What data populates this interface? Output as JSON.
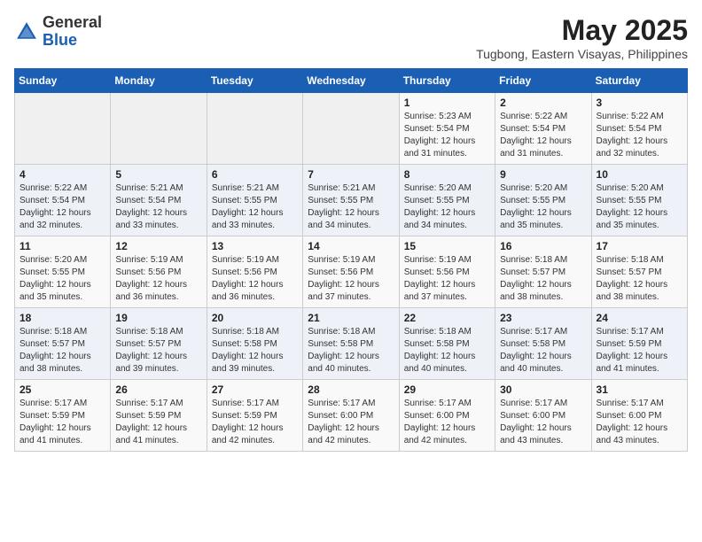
{
  "header": {
    "logo_general": "General",
    "logo_blue": "Blue",
    "month_year": "May 2025",
    "location": "Tugbong, Eastern Visayas, Philippines"
  },
  "weekdays": [
    "Sunday",
    "Monday",
    "Tuesday",
    "Wednesday",
    "Thursday",
    "Friday",
    "Saturday"
  ],
  "weeks": [
    [
      {
        "day": "",
        "info": ""
      },
      {
        "day": "",
        "info": ""
      },
      {
        "day": "",
        "info": ""
      },
      {
        "day": "",
        "info": ""
      },
      {
        "day": "1",
        "sunrise": "5:23 AM",
        "sunset": "5:54 PM",
        "daylight": "12 hours and 31 minutes."
      },
      {
        "day": "2",
        "sunrise": "5:22 AM",
        "sunset": "5:54 PM",
        "daylight": "12 hours and 31 minutes."
      },
      {
        "day": "3",
        "sunrise": "5:22 AM",
        "sunset": "5:54 PM",
        "daylight": "12 hours and 32 minutes."
      }
    ],
    [
      {
        "day": "4",
        "sunrise": "5:22 AM",
        "sunset": "5:54 PM",
        "daylight": "12 hours and 32 minutes."
      },
      {
        "day": "5",
        "sunrise": "5:21 AM",
        "sunset": "5:54 PM",
        "daylight": "12 hours and 33 minutes."
      },
      {
        "day": "6",
        "sunrise": "5:21 AM",
        "sunset": "5:55 PM",
        "daylight": "12 hours and 33 minutes."
      },
      {
        "day": "7",
        "sunrise": "5:21 AM",
        "sunset": "5:55 PM",
        "daylight": "12 hours and 34 minutes."
      },
      {
        "day": "8",
        "sunrise": "5:20 AM",
        "sunset": "5:55 PM",
        "daylight": "12 hours and 34 minutes."
      },
      {
        "day": "9",
        "sunrise": "5:20 AM",
        "sunset": "5:55 PM",
        "daylight": "12 hours and 35 minutes."
      },
      {
        "day": "10",
        "sunrise": "5:20 AM",
        "sunset": "5:55 PM",
        "daylight": "12 hours and 35 minutes."
      }
    ],
    [
      {
        "day": "11",
        "sunrise": "5:20 AM",
        "sunset": "5:55 PM",
        "daylight": "12 hours and 35 minutes."
      },
      {
        "day": "12",
        "sunrise": "5:19 AM",
        "sunset": "5:56 PM",
        "daylight": "12 hours and 36 minutes."
      },
      {
        "day": "13",
        "sunrise": "5:19 AM",
        "sunset": "5:56 PM",
        "daylight": "12 hours and 36 minutes."
      },
      {
        "day": "14",
        "sunrise": "5:19 AM",
        "sunset": "5:56 PM",
        "daylight": "12 hours and 37 minutes."
      },
      {
        "day": "15",
        "sunrise": "5:19 AM",
        "sunset": "5:56 PM",
        "daylight": "12 hours and 37 minutes."
      },
      {
        "day": "16",
        "sunrise": "5:18 AM",
        "sunset": "5:57 PM",
        "daylight": "12 hours and 38 minutes."
      },
      {
        "day": "17",
        "sunrise": "5:18 AM",
        "sunset": "5:57 PM",
        "daylight": "12 hours and 38 minutes."
      }
    ],
    [
      {
        "day": "18",
        "sunrise": "5:18 AM",
        "sunset": "5:57 PM",
        "daylight": "12 hours and 38 minutes."
      },
      {
        "day": "19",
        "sunrise": "5:18 AM",
        "sunset": "5:57 PM",
        "daylight": "12 hours and 39 minutes."
      },
      {
        "day": "20",
        "sunrise": "5:18 AM",
        "sunset": "5:58 PM",
        "daylight": "12 hours and 39 minutes."
      },
      {
        "day": "21",
        "sunrise": "5:18 AM",
        "sunset": "5:58 PM",
        "daylight": "12 hours and 40 minutes."
      },
      {
        "day": "22",
        "sunrise": "5:18 AM",
        "sunset": "5:58 PM",
        "daylight": "12 hours and 40 minutes."
      },
      {
        "day": "23",
        "sunrise": "5:17 AM",
        "sunset": "5:58 PM",
        "daylight": "12 hours and 40 minutes."
      },
      {
        "day": "24",
        "sunrise": "5:17 AM",
        "sunset": "5:59 PM",
        "daylight": "12 hours and 41 minutes."
      }
    ],
    [
      {
        "day": "25",
        "sunrise": "5:17 AM",
        "sunset": "5:59 PM",
        "daylight": "12 hours and 41 minutes."
      },
      {
        "day": "26",
        "sunrise": "5:17 AM",
        "sunset": "5:59 PM",
        "daylight": "12 hours and 41 minutes."
      },
      {
        "day": "27",
        "sunrise": "5:17 AM",
        "sunset": "5:59 PM",
        "daylight": "12 hours and 42 minutes."
      },
      {
        "day": "28",
        "sunrise": "5:17 AM",
        "sunset": "6:00 PM",
        "daylight": "12 hours and 42 minutes."
      },
      {
        "day": "29",
        "sunrise": "5:17 AM",
        "sunset": "6:00 PM",
        "daylight": "12 hours and 42 minutes."
      },
      {
        "day": "30",
        "sunrise": "5:17 AM",
        "sunset": "6:00 PM",
        "daylight": "12 hours and 43 minutes."
      },
      {
        "day": "31",
        "sunrise": "5:17 AM",
        "sunset": "6:00 PM",
        "daylight": "12 hours and 43 minutes."
      }
    ]
  ]
}
